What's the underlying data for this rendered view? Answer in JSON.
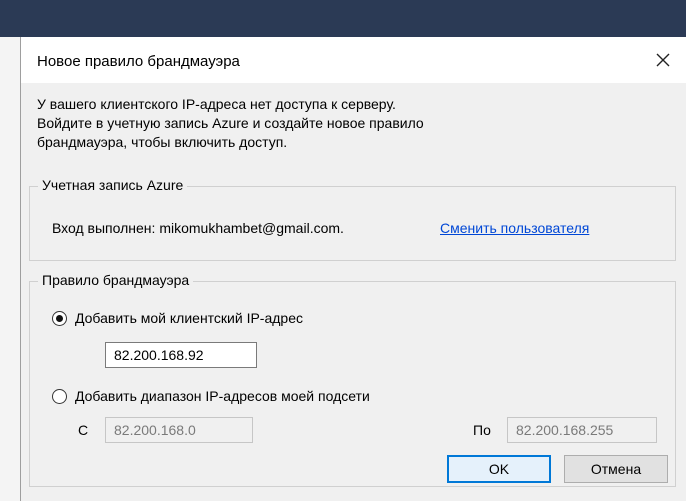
{
  "dialog": {
    "title": "Новое правило брандмауэра",
    "message_lines": [
      "У вашего клиентского IP-адреса нет доступа к серверу.",
      "Войдите в учетную запись Azure и создайте новое правило",
      "брандмауэра, чтобы включить доступ."
    ]
  },
  "account": {
    "legend": "Учетная запись Azure",
    "signed_in_text": "Вход выполнен: mikomukhambet@gmail.com.",
    "switch_user_label": "Сменить пользователя"
  },
  "rule": {
    "legend": "Правило брандмауэра",
    "option_client_ip": {
      "label": "Добавить мой клиентский IP-адрес",
      "checked": true,
      "value": "82.200.168.92"
    },
    "option_range": {
      "label": "Добавить диапазон IP-адресов моей подсети",
      "checked": false,
      "from_label": "С",
      "from_value": "82.200.168.0",
      "to_label": "По",
      "to_value": "82.200.168.255"
    }
  },
  "buttons": {
    "ok": "OK",
    "cancel": "Отмена"
  },
  "colors": {
    "link": "#0047d6",
    "default_button_border": "#0078d7"
  },
  "icons": {
    "close": "close-icon"
  }
}
